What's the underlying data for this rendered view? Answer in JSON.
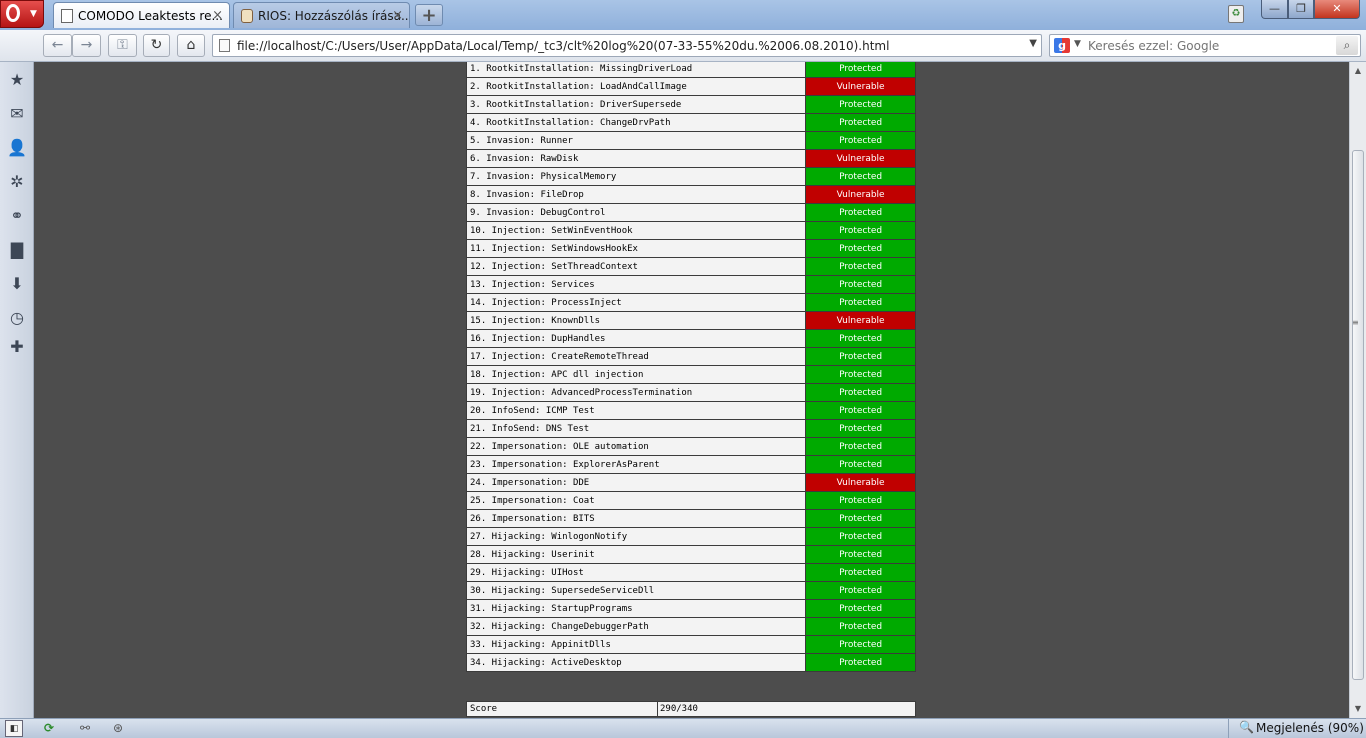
{
  "tabs": [
    {
      "label": "COMODO Leaktests re...",
      "close": "×",
      "active": true
    },
    {
      "label": "RIOS: Hozzászólás írása...",
      "close": "×",
      "active": false
    }
  ],
  "new_tab_label": "+",
  "window_controls": {
    "minimize": "—",
    "maximize": "❐",
    "close": "✕"
  },
  "navbar": {
    "back": "←",
    "forward": "→",
    "wand": "⚿",
    "reload": "↻",
    "home": "⌂",
    "url": "file://localhost/C:/Users/User/AppData/Local/Temp/_tc3/clt%20log%20(07-33-55%20du.%2006.08.2010).html",
    "search_placeholder": "Keresés ezzel: Google",
    "search_engine": "g",
    "dropdown": "▼",
    "search_go": "⌕"
  },
  "sidebar_icons": [
    {
      "name": "bookmarks-icon",
      "glyph": "★"
    },
    {
      "name": "mail-icon",
      "glyph": "✉"
    },
    {
      "name": "contacts-icon",
      "glyph": "👤"
    },
    {
      "name": "widgets-icon",
      "glyph": "✲"
    },
    {
      "name": "unite-icon",
      "glyph": "⚭"
    },
    {
      "name": "notes-icon",
      "glyph": "▇"
    },
    {
      "name": "downloads-icon",
      "glyph": "⬇"
    },
    {
      "name": "history-icon",
      "glyph": "◷"
    },
    {
      "name": "add-panel-icon",
      "glyph": "✚"
    }
  ],
  "results": {
    "rows": [
      {
        "name": "1. RootkitInstallation: MissingDriverLoad",
        "status": "Protected"
      },
      {
        "name": "2. RootkitInstallation: LoadAndCallImage",
        "status": "Vulnerable"
      },
      {
        "name": "3. RootkitInstallation: DriverSupersede",
        "status": "Protected"
      },
      {
        "name": "4. RootkitInstallation: ChangeDrvPath",
        "status": "Protected"
      },
      {
        "name": "5. Invasion: Runner",
        "status": "Protected"
      },
      {
        "name": "6. Invasion: RawDisk",
        "status": "Vulnerable"
      },
      {
        "name": "7. Invasion: PhysicalMemory",
        "status": "Protected"
      },
      {
        "name": "8. Invasion: FileDrop",
        "status": "Vulnerable"
      },
      {
        "name": "9. Invasion: DebugControl",
        "status": "Protected"
      },
      {
        "name": "10. Injection: SetWinEventHook",
        "status": "Protected"
      },
      {
        "name": "11. Injection: SetWindowsHookEx",
        "status": "Protected"
      },
      {
        "name": "12. Injection: SetThreadContext",
        "status": "Protected"
      },
      {
        "name": "13. Injection: Services",
        "status": "Protected"
      },
      {
        "name": "14. Injection: ProcessInject",
        "status": "Protected"
      },
      {
        "name": "15. Injection: KnownDlls",
        "status": "Vulnerable"
      },
      {
        "name": "16. Injection: DupHandles",
        "status": "Protected"
      },
      {
        "name": "17. Injection: CreateRemoteThread",
        "status": "Protected"
      },
      {
        "name": "18. Injection: APC dll injection",
        "status": "Protected"
      },
      {
        "name": "19. Injection: AdvancedProcessTermination",
        "status": "Protected"
      },
      {
        "name": "20. InfoSend: ICMP Test",
        "status": "Protected"
      },
      {
        "name": "21. InfoSend: DNS Test",
        "status": "Protected"
      },
      {
        "name": "22. Impersonation: OLE automation",
        "status": "Protected"
      },
      {
        "name": "23. Impersonation: ExplorerAsParent",
        "status": "Protected"
      },
      {
        "name": "24. Impersonation: DDE",
        "status": "Vulnerable"
      },
      {
        "name": "25. Impersonation: Coat",
        "status": "Protected"
      },
      {
        "name": "26. Impersonation: BITS",
        "status": "Protected"
      },
      {
        "name": "27. Hijacking: WinlogonNotify",
        "status": "Protected"
      },
      {
        "name": "28. Hijacking: Userinit",
        "status": "Protected"
      },
      {
        "name": "29. Hijacking: UIHost",
        "status": "Protected"
      },
      {
        "name": "30. Hijacking: SupersedeServiceDll",
        "status": "Protected"
      },
      {
        "name": "31. Hijacking: StartupPrograms",
        "status": "Protected"
      },
      {
        "name": "32. Hijacking: ChangeDebuggerPath",
        "status": "Protected"
      },
      {
        "name": "33. Hijacking: AppinitDlls",
        "status": "Protected"
      },
      {
        "name": "34. Hijacking: ActiveDesktop",
        "status": "Protected"
      }
    ],
    "score_label": "Score",
    "score_value": "290/340"
  },
  "colors": {
    "protected": "#00aa00",
    "vulnerable": "#c00000"
  },
  "scrollbar": {
    "up": "▲",
    "down": "▼",
    "grip": "≡"
  },
  "statusbar": {
    "panel": "◧",
    "update": "⟳",
    "turbo": "⚯",
    "shield": "⊛",
    "zoom_icon": "🔍",
    "zoom_label": "Megjelenés (90%)"
  }
}
